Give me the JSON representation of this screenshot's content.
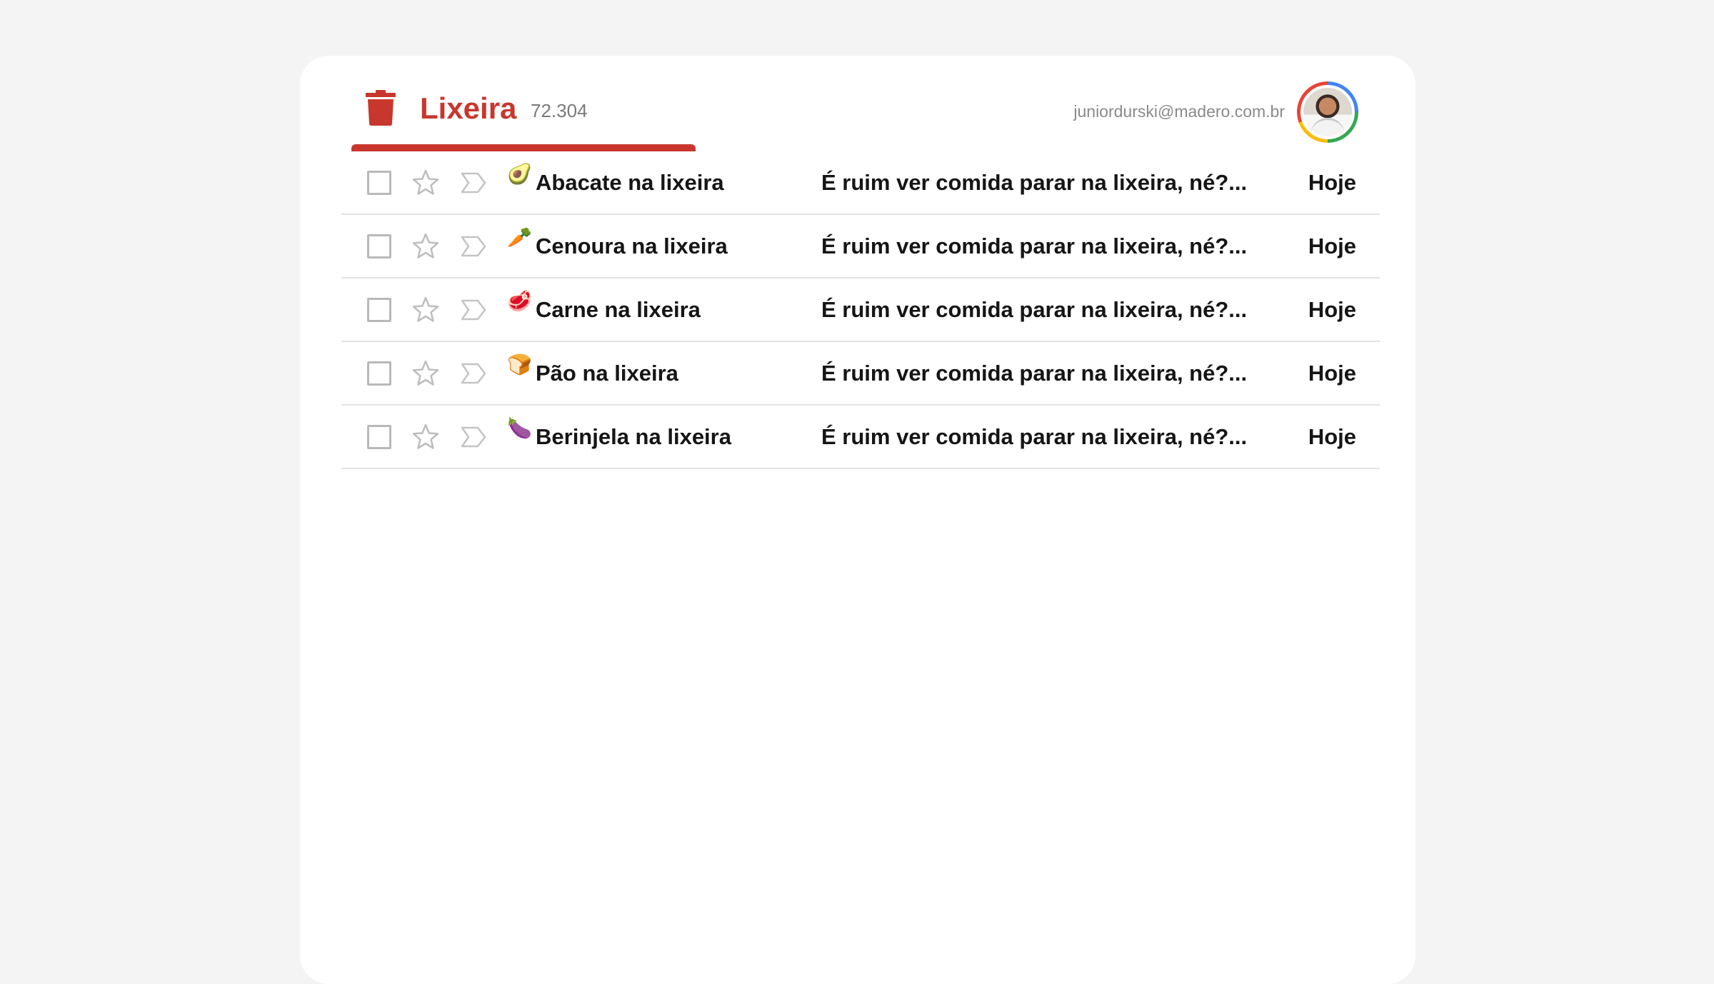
{
  "header": {
    "title": "Lixeira",
    "count": "72.304",
    "account_email": "juniordurski@madero.com.br",
    "accent_color": "#c8372d"
  },
  "messages": [
    {
      "emoji": "🥑",
      "icon": "avocado-icon",
      "sender": "Abacate na lixeira",
      "subject": "É ruim ver comida parar na lixeira, né?...",
      "date": "Hoje"
    },
    {
      "emoji": "🥕",
      "icon": "carrot-icon",
      "sender": "Cenoura na lixeira",
      "subject": "É ruim ver comida parar na lixeira, né?...",
      "date": "Hoje"
    },
    {
      "emoji": "🥩",
      "icon": "meat-icon",
      "sender": "Carne na lixeira",
      "subject": "É ruim ver comida parar na lixeira, né?...",
      "date": "Hoje"
    },
    {
      "emoji": "🍞",
      "icon": "bread-icon",
      "sender": "Pão na lixeira",
      "subject": "É ruim ver comida parar na lixeira, né?...",
      "date": "Hoje"
    },
    {
      "emoji": "🍆",
      "icon": "eggplant-icon",
      "sender": "Berinjela na lixeira",
      "subject": "É ruim ver comida parar na lixeira, né?...",
      "date": "Hoje"
    }
  ]
}
